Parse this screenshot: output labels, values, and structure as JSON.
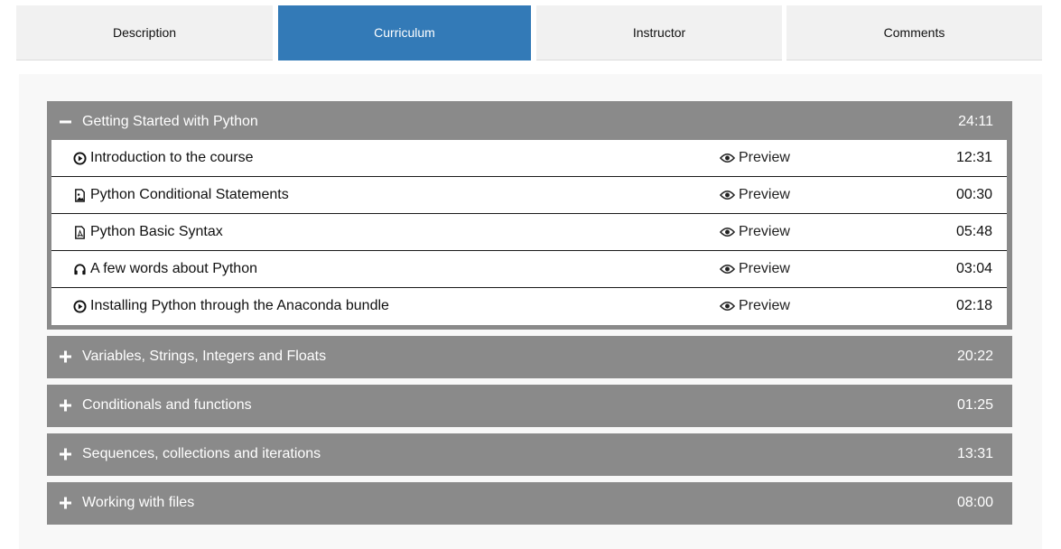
{
  "tabs": [
    {
      "label": "Description",
      "active": false
    },
    {
      "label": "Curriculum",
      "active": true
    },
    {
      "label": "Instructor",
      "active": false
    },
    {
      "label": "Comments",
      "active": false
    }
  ],
  "colors": {
    "accent": "#337ab7",
    "section_bg": "#8a8a8a",
    "tab_bg": "#f1f1f1"
  },
  "sections": [
    {
      "title": "Getting Started with Python",
      "duration": "24:11",
      "expanded": true,
      "lessons": [
        {
          "icon": "play-circle-icon",
          "title": "Introduction to the course",
          "preview": "Preview",
          "duration": "12:31"
        },
        {
          "icon": "image-file-icon",
          "title": "Python Conditional Statements",
          "preview": "Preview",
          "duration": "00:30"
        },
        {
          "icon": "pdf-file-icon",
          "title": "Python Basic Syntax",
          "preview": "Preview",
          "duration": "05:48"
        },
        {
          "icon": "headphones-icon",
          "title": "A few words about Python",
          "preview": "Preview",
          "duration": "03:04"
        },
        {
          "icon": "play-circle-icon",
          "title": "Installing Python through the Anaconda bundle",
          "preview": "Preview",
          "duration": "02:18"
        }
      ]
    },
    {
      "title": "Variables, Strings, Integers and Floats",
      "duration": "20:22",
      "expanded": false
    },
    {
      "title": "Conditionals and functions",
      "duration": "01:25",
      "expanded": false
    },
    {
      "title": "Sequences, collections and iterations",
      "duration": "13:31",
      "expanded": false
    },
    {
      "title": "Working with files",
      "duration": "08:00",
      "expanded": false
    }
  ]
}
